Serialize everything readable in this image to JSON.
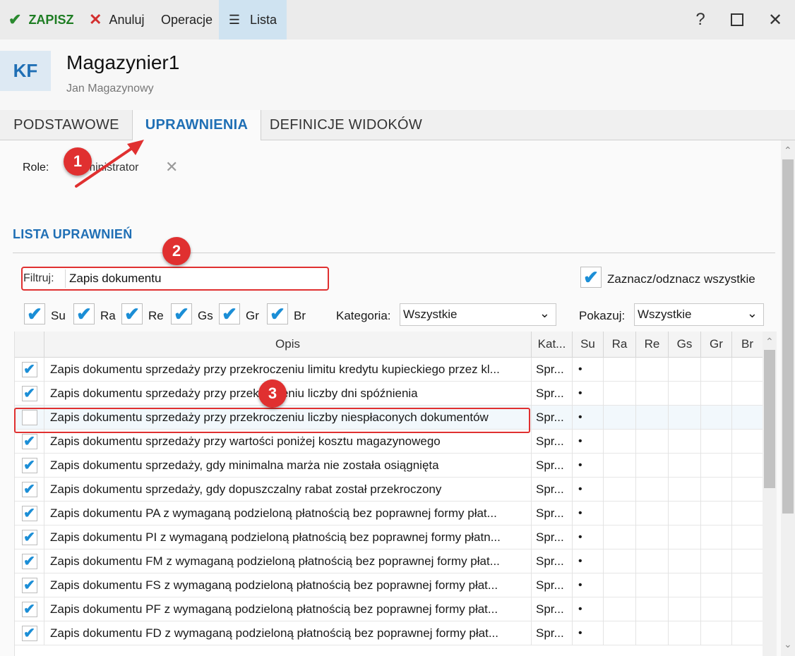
{
  "toolbar": {
    "save_label": "ZAPISZ",
    "cancel_label": "Anuluj",
    "operations_label": "Operacje",
    "list_label": "Lista"
  },
  "header": {
    "initials": "KF",
    "title": "Magazynier1",
    "subtitle": "Jan Magazynowy"
  },
  "tabs": [
    {
      "label": "PODSTAWOWE"
    },
    {
      "label": "UPRAWNIENIA"
    },
    {
      "label": "DEFINICJE WIDOKÓW"
    }
  ],
  "roles": {
    "label": "Role:",
    "value": "*Administrator"
  },
  "permissions": {
    "section_title": "LISTA UPRAWNIEŃ",
    "filter_label": "Filtruj:",
    "filter_value": "Zapis dokumentu",
    "select_all_label": "Zaznacz/odznacz wszystkie",
    "flags": [
      {
        "label": "Su",
        "checked": true
      },
      {
        "label": "Ra",
        "checked": true
      },
      {
        "label": "Re",
        "checked": true
      },
      {
        "label": "Gs",
        "checked": true
      },
      {
        "label": "Gr",
        "checked": true
      },
      {
        "label": "Br",
        "checked": true
      }
    ],
    "category_label": "Kategoria:",
    "category_value": "Wszystkie",
    "show_label": "Pokazuj:",
    "show_value": "Wszystkie"
  },
  "grid": {
    "columns": [
      "Opis",
      "Kat...",
      "Su",
      "Ra",
      "Re",
      "Gs",
      "Gr",
      "Br"
    ],
    "rows": [
      {
        "checked": true,
        "opis": "Zapis dokumentu sprzedaży przy przekroczeniu limitu kredytu kupieckiego przez kl...",
        "kat": "Spr...",
        "su": "•"
      },
      {
        "checked": true,
        "opis": "Zapis dokumentu sprzedaży przy przekroczeniu liczby dni spóźnienia",
        "kat": "Spr...",
        "su": "•"
      },
      {
        "checked": false,
        "opis": "Zapis dokumentu sprzedaży przy przekroczeniu liczby niespłaconych dokumentów",
        "kat": "Spr...",
        "su": "•"
      },
      {
        "checked": true,
        "opis": "Zapis dokumentu sprzedaży przy wartości poniżej kosztu magazynowego",
        "kat": "Spr...",
        "su": "•"
      },
      {
        "checked": true,
        "opis": "Zapis dokumentu sprzedaży, gdy minimalna marża nie została osiągnięta",
        "kat": "Spr...",
        "su": "•"
      },
      {
        "checked": true,
        "opis": "Zapis dokumentu sprzedaży, gdy dopuszczalny rabat został przekroczony",
        "kat": "Spr...",
        "su": "•"
      },
      {
        "checked": true,
        "opis": "Zapis dokumentu PA z wymaganą podzieloną płatnością bez poprawnej formy płat...",
        "kat": "Spr...",
        "su": "•"
      },
      {
        "checked": true,
        "opis": "Zapis dokumentu PI z wymaganą podzieloną płatnością bez poprawnej formy płatn...",
        "kat": "Spr...",
        "su": "•"
      },
      {
        "checked": true,
        "opis": "Zapis dokumentu FM z wymaganą podzieloną płatnością bez poprawnej formy płat...",
        "kat": "Spr...",
        "su": "•"
      },
      {
        "checked": true,
        "opis": "Zapis dokumentu FS z wymaganą podzieloną płatnością bez poprawnej formy płat...",
        "kat": "Spr...",
        "su": "•"
      },
      {
        "checked": true,
        "opis": "Zapis dokumentu PF z wymaganą podzieloną płatnością bez poprawnej formy płat...",
        "kat": "Spr...",
        "su": "•"
      },
      {
        "checked": true,
        "opis": "Zapis dokumentu FD z wymaganą podzieloną płatnością bez poprawnej formy płat...",
        "kat": "Spr...",
        "su": "•"
      }
    ]
  },
  "annotations": [
    "1",
    "2",
    "3"
  ],
  "colors": {
    "accent": "#1f6fb5",
    "save_green": "#1e7d23",
    "cancel_red": "#d32f2f",
    "annotation_red": "#e03030",
    "checkbox_blue": "#1b8ed6"
  }
}
